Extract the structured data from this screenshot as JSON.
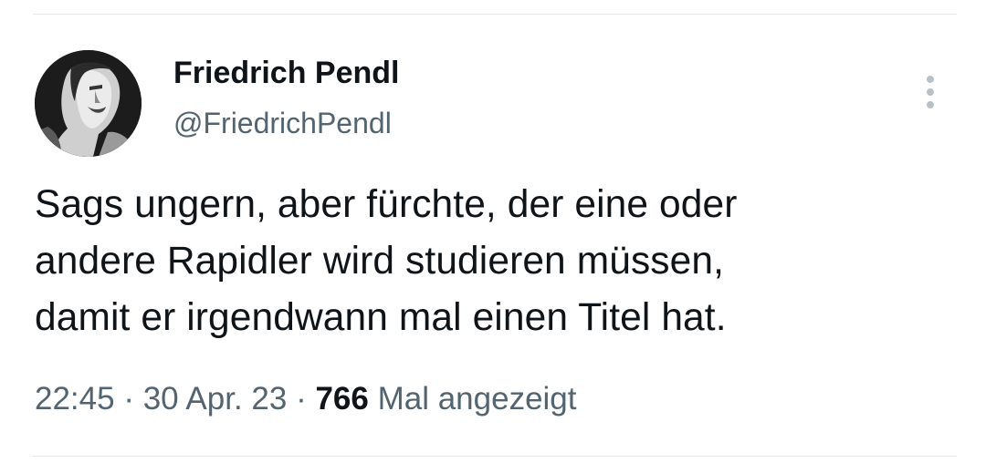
{
  "author": {
    "name": "Friedrich Pendl",
    "handle": "@FriedrichPendl",
    "avatar_icon": "profile-photo-icon"
  },
  "tweet": {
    "lines": [
      "Sags ungern, aber fürchte, der eine oder",
      "andere Rapidler wird studieren müssen,",
      "damit er irgendwann mal einen Titel hat."
    ]
  },
  "meta": {
    "time": "22:45",
    "separator": " · ",
    "date": "30 Apr. 23",
    "views_count": "766",
    "views_label": " Mal angezeigt"
  },
  "more_icon": "more-vertical-icon",
  "colors": {
    "text_primary": "#0f1419",
    "text_secondary": "#536471",
    "divider": "#e6e9eb"
  }
}
